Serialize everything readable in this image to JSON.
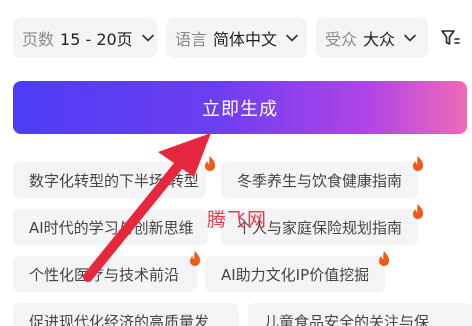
{
  "filters": {
    "pages": {
      "label": "页数",
      "value": "15 - 20页"
    },
    "language": {
      "label": "语言",
      "value": "简体中文"
    },
    "audience": {
      "label": "受众",
      "value": "大众"
    }
  },
  "generate_button": "立即生成",
  "topics": [
    {
      "text": "数字化转型的下半场 转型",
      "hot": true
    },
    {
      "text": "冬季养生与饮食健康指南",
      "hot": true
    },
    {
      "text": "AI时代的学习与创新思维",
      "hot": false
    },
    {
      "text": "个人与家庭保险规划指南",
      "hot": true
    },
    {
      "text": "个性化医疗与技术前沿",
      "hot": true
    },
    {
      "text": "AI助力文化IP价值挖掘",
      "hot": true
    },
    {
      "text": "促进现代化经济的高质量发",
      "hot": false
    },
    {
      "text": "儿童食品安全的关注与保",
      "hot": false
    }
  ],
  "watermark": "腾飞网",
  "colors": {
    "accent_start": "#4d3cf6",
    "accent_end": "#f06ab8",
    "arrow": "#e5283d",
    "flame": "#f25a1c"
  }
}
